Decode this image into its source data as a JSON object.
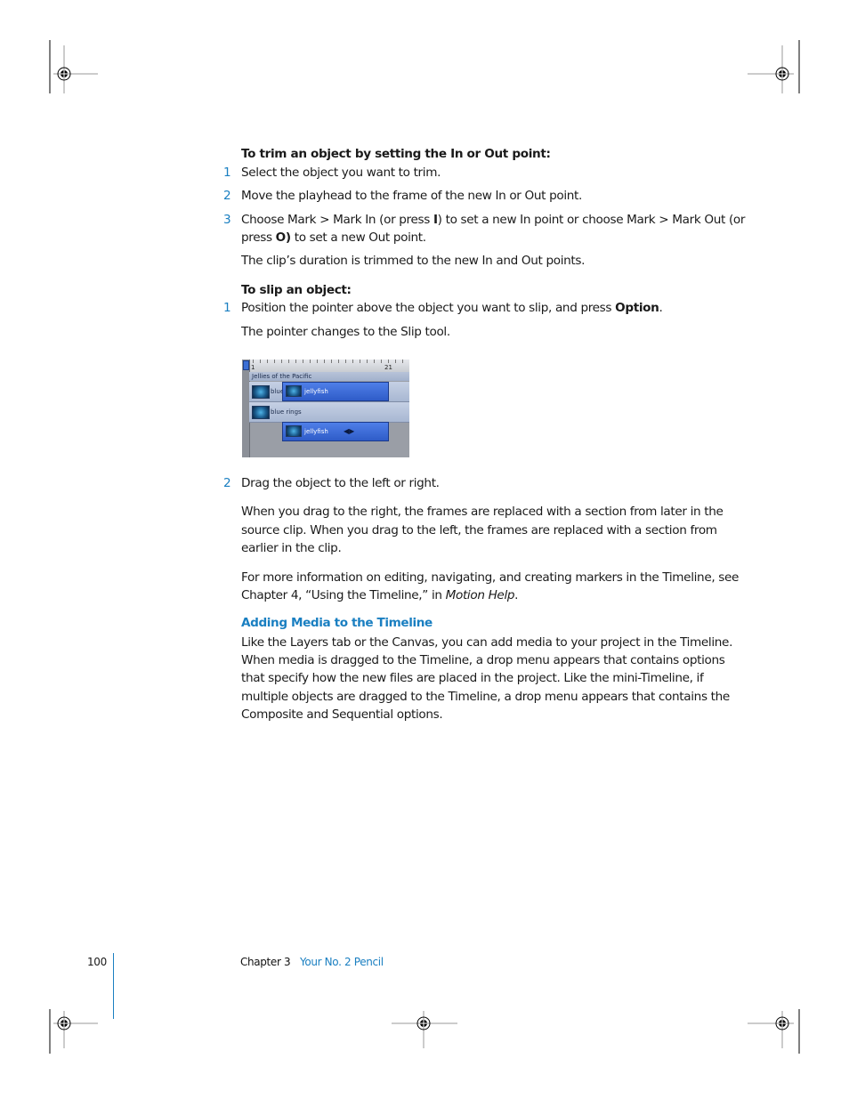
{
  "procedure_trim": {
    "heading": "To trim an object by setting the In or Out point:",
    "steps": [
      {
        "num": "1",
        "text": "Select the object you want to trim."
      },
      {
        "num": "2",
        "text": "Move the playhead to the frame of the new In or Out point."
      },
      {
        "num": "3",
        "text_before_i": "Choose Mark > Mark In (or press ",
        "key_i": "I",
        "text_after_i": ") to set a new In point or choose Mark > Mark Out (or",
        "line2_before": "press ",
        "key_o": "O)",
        "line2_after": " to set a new Out point."
      }
    ],
    "result": "The clip’s duration is trimmed to the new In and Out points."
  },
  "procedure_slip": {
    "heading": "To slip an object:",
    "step1": {
      "num": "1",
      "text_before": "Position the pointer above the object you want to slip, and press ",
      "key": "Option",
      "text_after": "."
    },
    "step1_result": "The pointer changes to the Slip tool.",
    "screenshot": {
      "ruler_labels": [
        "1",
        "21"
      ],
      "group_name": "Jellies of the Pacific",
      "layers": [
        {
          "name": "blue",
          "clip": "jellyfish"
        },
        {
          "name": "blue rings",
          "clip": "jellyfish"
        }
      ],
      "slip_icon": "slip-tool-icon",
      "slip_icon_glyph": "◀▶"
    },
    "step2": {
      "num": "2",
      "text": "Drag the object to the left or right."
    },
    "para1": [
      "When you drag to the right, the frames are replaced with a section from later in the",
      "source clip. When you drag to the left, the frames are replaced with a section from",
      "earlier in the clip."
    ],
    "para2_line1": "For more information on editing, navigating, and creating markers in the Timeline, see",
    "para2_line2_before": "Chapter 4, “Using the Timeline,” in ",
    "para2_line2_italic": "Motion Help",
    "para2_line2_after": "."
  },
  "section": {
    "heading": "Adding Media to the Timeline",
    "body": [
      "Like the Layers tab or the Canvas, you can add media to your project in the Timeline.",
      "When media is dragged to the Timeline, a drop menu appears that contains options",
      "that specify how the new files are placed in the project. Like the mini-Timeline, if",
      "multiple objects are dragged to the Timeline, a drop menu appears that contains the",
      "Composite and Sequential options."
    ]
  },
  "footer": {
    "page_number": "100",
    "chapter_label": "Chapter 3",
    "chapter_title": "Your No. 2 Pencil"
  },
  "colors": {
    "accent": "#1a7fc1",
    "text": "#1a1a1a"
  }
}
